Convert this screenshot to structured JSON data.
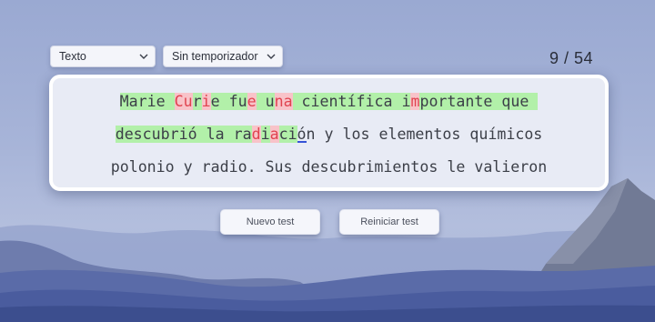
{
  "controls": {
    "mode_select": {
      "value": "Texto"
    },
    "timer_select": {
      "value": "Sin temporizador"
    }
  },
  "counter": {
    "text": "9 / 54"
  },
  "typing": {
    "lines": [
      [
        {
          "t": "Marie",
          "s": "c"
        },
        {
          "t": " ",
          "s": "c"
        },
        {
          "t": "Cu",
          "s": "w"
        },
        {
          "t": "r",
          "s": "c"
        },
        {
          "t": "i",
          "s": "w"
        },
        {
          "t": "e",
          "s": "c"
        },
        {
          "t": " ",
          "s": "c"
        },
        {
          "t": "fu",
          "s": "c"
        },
        {
          "t": "e",
          "s": "w"
        },
        {
          "t": " ",
          "s": "c"
        },
        {
          "t": "u",
          "s": "c"
        },
        {
          "t": "na",
          "s": "w"
        },
        {
          "t": " científica ",
          "s": "c"
        },
        {
          "t": "i",
          "s": "c"
        },
        {
          "t": "m",
          "s": "w"
        },
        {
          "t": "portante que ",
          "s": "c"
        }
      ],
      [
        {
          "t": "descubrió la ra",
          "s": "c"
        },
        {
          "t": "d",
          "s": "w"
        },
        {
          "t": "i",
          "s": "c"
        },
        {
          "t": "a",
          "s": "w"
        },
        {
          "t": "ci",
          "s": "c"
        },
        {
          "t": "ó",
          "s": "cur"
        },
        {
          "t": "n y los elementos químicos",
          "s": "u"
        }
      ],
      [
        {
          "t": "polonio y radio. Sus descubrimientos le valieron",
          "s": "u"
        }
      ]
    ]
  },
  "buttons": {
    "new_test": "Nuevo test",
    "restart_test": "Reiniciar test"
  },
  "colors": {
    "correct_bg": "#b2f0a9",
    "wrong_bg": "#f8c3c9",
    "wrong_text": "#e0434f",
    "cursor": "#3553d6"
  }
}
